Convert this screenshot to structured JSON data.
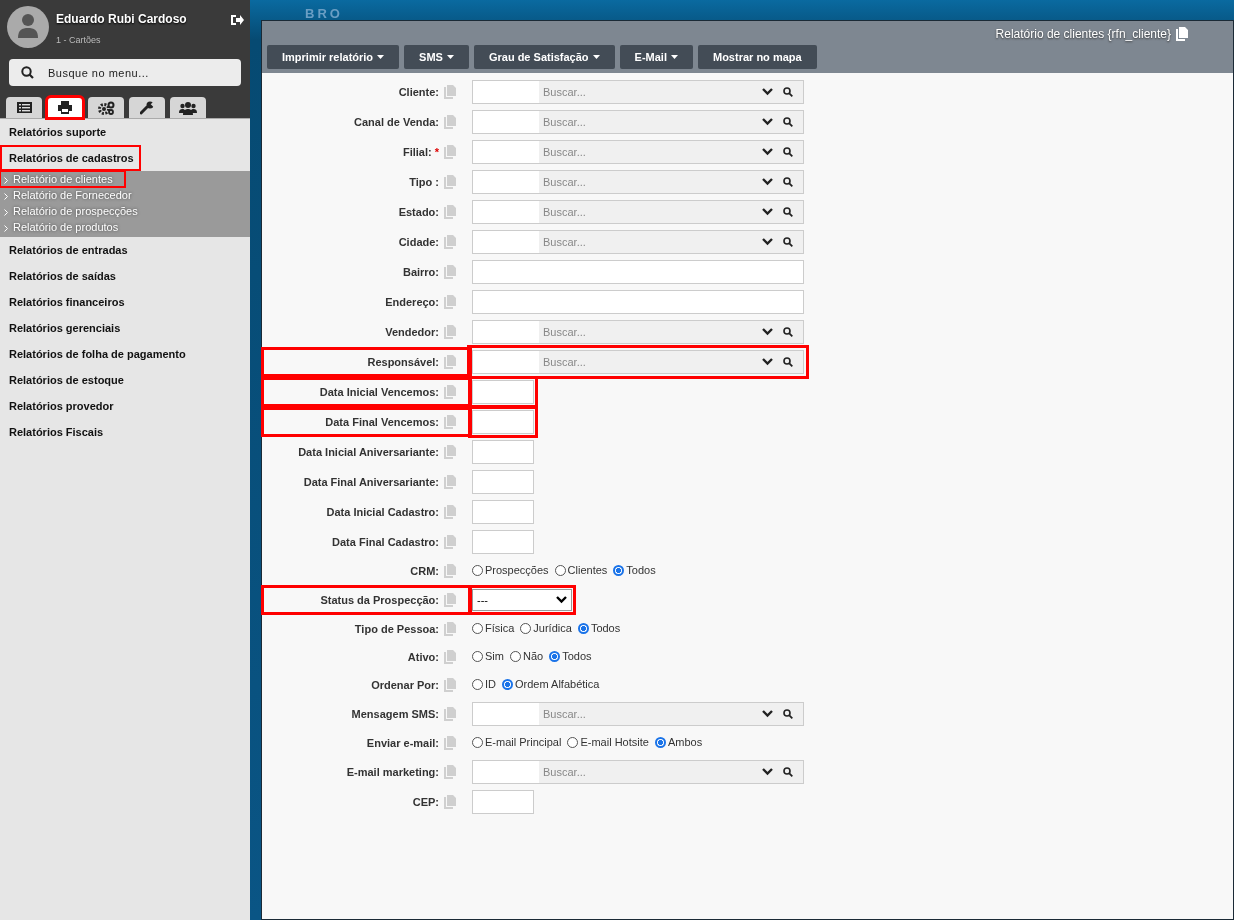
{
  "user": {
    "name": "Eduardo Rubi Cardoso",
    "subtitle": "1 - Cartões"
  },
  "menu_search": {
    "placeholder": "Busque no menu..."
  },
  "sidebar_tabs": [
    {
      "kind": "list",
      "selected": false,
      "highlighted": false
    },
    {
      "kind": "printer",
      "selected": true,
      "highlighted": true
    },
    {
      "kind": "gears",
      "selected": false,
      "highlighted": false
    },
    {
      "kind": "wrench",
      "selected": false,
      "highlighted": false
    },
    {
      "kind": "users",
      "selected": false,
      "highlighted": false
    }
  ],
  "sidebar": {
    "items": [
      {
        "label": "Relatórios suporte",
        "highlighted": false
      },
      {
        "label": "Relatórios de cadastros",
        "expanded": true,
        "highlighted": true,
        "children": [
          {
            "label": "Relatório de clientes",
            "highlighted": true
          },
          {
            "label": "Relatório de Fornecedor",
            "highlighted": false
          },
          {
            "label": "Relatório de prospecções",
            "highlighted": false
          },
          {
            "label": "Relatório de produtos",
            "highlighted": false
          }
        ]
      },
      {
        "label": "Relatórios de entradas",
        "highlighted": false
      },
      {
        "label": "Relatórios de saídas",
        "highlighted": false
      },
      {
        "label": "Relatórios financeiros",
        "highlighted": false
      },
      {
        "label": "Relatórios gerenciais",
        "highlighted": false
      },
      {
        "label": "Relatórios de folha de pagamento",
        "highlighted": false
      },
      {
        "label": "Relatórios de estoque",
        "highlighted": false
      },
      {
        "label": "Relatórios provedor",
        "highlighted": false
      },
      {
        "label": "Relatórios Fiscais",
        "highlighted": false
      }
    ]
  },
  "background_logo": "BRO",
  "window": {
    "title": "Relatório de clientes {rfn_cliente}"
  },
  "toolbar": [
    {
      "label": "Imprimir relatório",
      "dropdown": true
    },
    {
      "label": "SMS",
      "dropdown": true
    },
    {
      "label": "Grau de Satisfação",
      "dropdown": true
    },
    {
      "label": "E-Mail",
      "dropdown": true
    },
    {
      "label": "Mostrar no mapa",
      "dropdown": false
    }
  ],
  "fields": [
    {
      "label": "Cliente:",
      "kind": "lookup",
      "placeholder": "Buscar...",
      "required": false,
      "highlighted": false
    },
    {
      "label": "Canal de Venda:",
      "kind": "lookup",
      "placeholder": "Buscar...",
      "required": false,
      "highlighted": false
    },
    {
      "label": "Filial:",
      "kind": "lookup",
      "placeholder": "Buscar...",
      "required": true,
      "required_mark": "*",
      "highlighted": false
    },
    {
      "label": "Tipo :",
      "kind": "lookup",
      "placeholder": "Buscar...",
      "required": false,
      "highlighted": false
    },
    {
      "label": "Estado:",
      "kind": "lookup",
      "placeholder": "Buscar...",
      "required": false,
      "highlighted": false
    },
    {
      "label": "Cidade:",
      "kind": "lookup",
      "placeholder": "Buscar...",
      "required": false,
      "highlighted": false
    },
    {
      "label": "Bairro:",
      "kind": "text",
      "required": false,
      "highlighted": false
    },
    {
      "label": "Endereço:",
      "kind": "text",
      "required": false,
      "highlighted": false
    },
    {
      "label": "Vendedor:",
      "kind": "lookup",
      "placeholder": "Buscar...",
      "required": false,
      "highlighted": false
    },
    {
      "label": "Responsável:",
      "kind": "lookup",
      "placeholder": "Buscar...",
      "required": false,
      "highlighted": true
    },
    {
      "label": "Data Inicial Vencemos:",
      "kind": "date",
      "required": false,
      "highlighted": true
    },
    {
      "label": "Data Final Vencemos:",
      "kind": "date",
      "required": false,
      "highlighted": true
    },
    {
      "label": "Data Inicial Aniversariante:",
      "kind": "date",
      "required": false,
      "highlighted": false
    },
    {
      "label": "Data Final Aniversariante:",
      "kind": "date",
      "required": false,
      "highlighted": false
    },
    {
      "label": "Data Inicial Cadastro:",
      "kind": "date",
      "required": false,
      "highlighted": false
    },
    {
      "label": "Data Final Cadastro:",
      "kind": "date",
      "required": false,
      "highlighted": false
    },
    {
      "label": "CRM:",
      "kind": "radio",
      "required": false,
      "highlighted": false,
      "options": [
        {
          "label": "Prospecções",
          "selected": false
        },
        {
          "label": "Clientes",
          "selected": false
        },
        {
          "label": "Todos",
          "selected": true
        }
      ]
    },
    {
      "label": "Status da Prospecção:",
      "kind": "select",
      "value": "---",
      "required": false,
      "highlighted": true
    },
    {
      "label": "Tipo de Pessoa:",
      "kind": "radio",
      "required": false,
      "highlighted": false,
      "options": [
        {
          "label": "Física",
          "selected": false
        },
        {
          "label": "Jurídica",
          "selected": false
        },
        {
          "label": "Todos",
          "selected": true
        }
      ]
    },
    {
      "label": "Ativo:",
      "kind": "radio",
      "required": false,
      "highlighted": false,
      "options": [
        {
          "label": "Sim",
          "selected": false
        },
        {
          "label": "Não",
          "selected": false
        },
        {
          "label": "Todos",
          "selected": true
        }
      ]
    },
    {
      "label": "Ordenar Por:",
      "kind": "radio",
      "required": false,
      "highlighted": false,
      "options": [
        {
          "label": "ID",
          "selected": false
        },
        {
          "label": "Ordem Alfabética",
          "selected": true
        }
      ]
    },
    {
      "label": "Mensagem SMS:",
      "kind": "lookup",
      "placeholder": "Buscar...",
      "required": false,
      "highlighted": false
    },
    {
      "label": "Enviar e-mail:",
      "kind": "radio",
      "required": false,
      "highlighted": false,
      "options": [
        {
          "label": "E-mail Principal",
          "selected": false
        },
        {
          "label": "E-mail Hotsite",
          "selected": false
        },
        {
          "label": "Ambos",
          "selected": true
        }
      ]
    },
    {
      "label": "E-mail marketing:",
      "kind": "lookup",
      "placeholder": "Buscar...",
      "required": false,
      "highlighted": false
    },
    {
      "label": "CEP:",
      "kind": "date",
      "required": false,
      "highlighted": false
    }
  ]
}
